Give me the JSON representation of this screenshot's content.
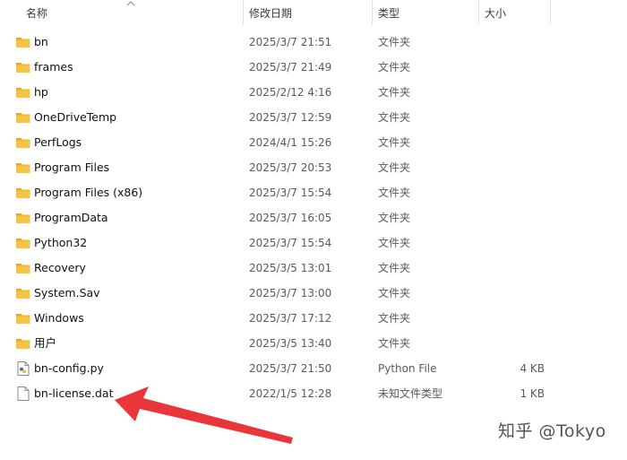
{
  "columns": {
    "name": "名称",
    "date": "修改日期",
    "type": "类型",
    "size": "大小"
  },
  "files": [
    {
      "name": "bn",
      "date": "2025/3/7 21:51",
      "type": "文件夹",
      "size": "",
      "icon": "folder-icon"
    },
    {
      "name": "frames",
      "date": "2025/3/7 21:49",
      "type": "文件夹",
      "size": "",
      "icon": "folder-icon"
    },
    {
      "name": "hp",
      "date": "2025/2/12 4:16",
      "type": "文件夹",
      "size": "",
      "icon": "folder-icon"
    },
    {
      "name": "OneDriveTemp",
      "date": "2025/3/7 12:59",
      "type": "文件夹",
      "size": "",
      "icon": "folder-icon"
    },
    {
      "name": "PerfLogs",
      "date": "2024/4/1 15:26",
      "type": "文件夹",
      "size": "",
      "icon": "folder-icon"
    },
    {
      "name": "Program Files",
      "date": "2025/3/7 20:53",
      "type": "文件夹",
      "size": "",
      "icon": "folder-icon"
    },
    {
      "name": "Program Files (x86)",
      "date": "2025/3/7 15:54",
      "type": "文件夹",
      "size": "",
      "icon": "folder-icon"
    },
    {
      "name": "ProgramData",
      "date": "2025/3/7 16:05",
      "type": "文件夹",
      "size": "",
      "icon": "folder-icon"
    },
    {
      "name": "Python32",
      "date": "2025/3/7 15:54",
      "type": "文件夹",
      "size": "",
      "icon": "folder-icon"
    },
    {
      "name": "Recovery",
      "date": "2025/3/5 13:01",
      "type": "文件夹",
      "size": "",
      "icon": "folder-icon"
    },
    {
      "name": "System.Sav",
      "date": "2025/3/7 13:00",
      "type": "文件夹",
      "size": "",
      "icon": "folder-icon"
    },
    {
      "name": "Windows",
      "date": "2025/3/7 17:12",
      "type": "文件夹",
      "size": "",
      "icon": "folder-icon"
    },
    {
      "name": "用户",
      "date": "2025/3/5 13:40",
      "type": "文件夹",
      "size": "",
      "icon": "folder-icon"
    },
    {
      "name": "bn-config.py",
      "date": "2025/3/7 21:50",
      "type": "Python File",
      "size": "4 KB",
      "icon": "python-file-icon"
    },
    {
      "name": "bn-license.dat",
      "date": "2022/1/5 12:28",
      "type": "未知文件类型",
      "size": "1 KB",
      "icon": "document-icon"
    }
  ],
  "watermark": "知乎 @Tokyo",
  "colors": {
    "folder": "#f6c344",
    "folder_dark": "#e8ab25",
    "arrow": "#e8363b"
  }
}
